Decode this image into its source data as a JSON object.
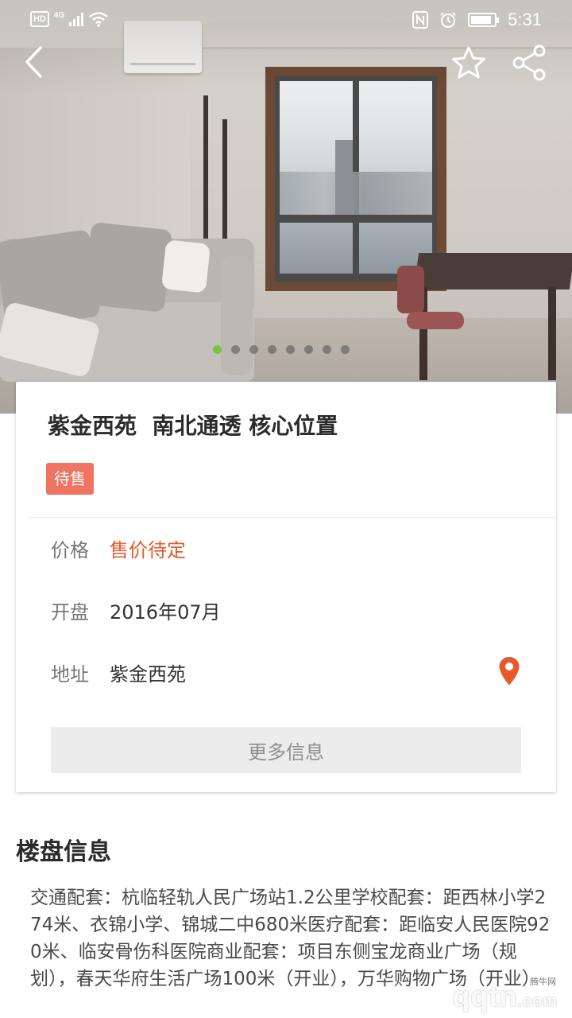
{
  "status_bar": {
    "hd": "HD",
    "network": "4G",
    "time": "5:31",
    "battery_level": 0.9
  },
  "nav": {
    "back_icon": "back-chevron-icon",
    "favorite_icon": "star-outline-icon",
    "share_icon": "share-icon"
  },
  "gallery": {
    "total_images": 8,
    "active_index": 0,
    "active_dot_color": "#7cc242"
  },
  "property": {
    "title": "紫金西苑  南北通透 核心位置",
    "status_badge": "待售",
    "status_badge_color": "#ef7462",
    "rows": [
      {
        "label": "价格",
        "value": "售价待定",
        "accent": true
      },
      {
        "label": "开盘",
        "value": "2016年07月"
      },
      {
        "label": "地址",
        "value": "紫金西苑"
      }
    ],
    "accent_color": "#e5592a",
    "location_icon": "map-pin-icon",
    "more_button": "更多信息"
  },
  "section": {
    "title": "楼盘信息",
    "body": "交通配套：杭临轻轨人民广场站1.2公里学校配套：距西林小学274米、衣锦小学、锦城二中680米医疗配套：距临安人民医院920米、临安骨伤科医院商业配套：项目东侧宝龙商业广场（规划），春天华府生活广场100米（开业），万华购物广场（开业）"
  },
  "watermark": {
    "small": "腾牛网",
    "logo": "qqtn",
    "logo_suffix": ".com"
  }
}
